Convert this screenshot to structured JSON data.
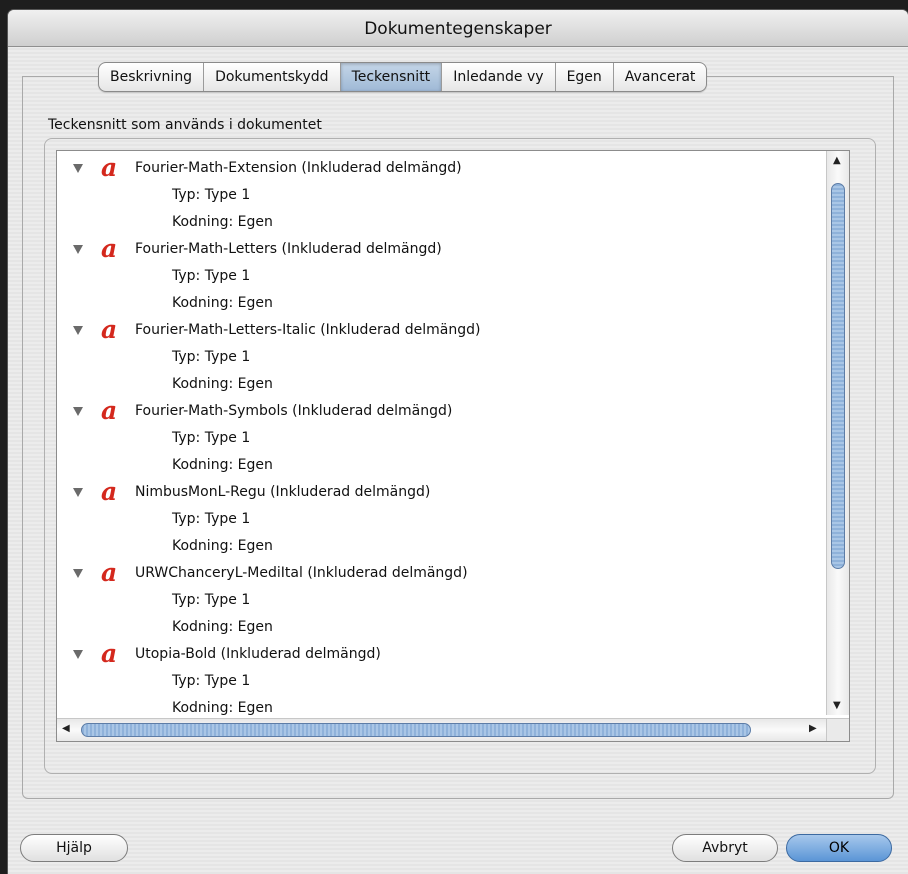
{
  "window": {
    "title": "Dokumentegenskaper"
  },
  "tabs": [
    {
      "label": "Beskrivning"
    },
    {
      "label": "Dokumentskydd"
    },
    {
      "label": "Teckensnitt",
      "active": true
    },
    {
      "label": "Inledande vy"
    },
    {
      "label": "Egen"
    },
    {
      "label": "Avancerat"
    }
  ],
  "fonts_section": {
    "label": "Teckensnitt som används i dokumentet"
  },
  "fonts": [
    {
      "name": "Fourier-Math-Extension (Inkluderad delmängd)",
      "type": "Typ: Type 1",
      "encoding": "Kodning: Egen"
    },
    {
      "name": "Fourier-Math-Letters (Inkluderad delmängd)",
      "type": "Typ: Type 1",
      "encoding": "Kodning: Egen"
    },
    {
      "name": "Fourier-Math-Letters-Italic (Inkluderad delmängd)",
      "type": "Typ: Type 1",
      "encoding": "Kodning: Egen"
    },
    {
      "name": "Fourier-Math-Symbols (Inkluderad delmängd)",
      "type": "Typ: Type 1",
      "encoding": "Kodning: Egen"
    },
    {
      "name": "NimbusMonL-Regu (Inkluderad delmängd)",
      "type": "Typ: Type 1",
      "encoding": "Kodning: Egen"
    },
    {
      "name": "URWChanceryL-MediItal (Inkluderad delmängd)",
      "type": "Typ: Type 1",
      "encoding": "Kodning: Egen"
    },
    {
      "name": "Utopia-Bold (Inkluderad delmängd)",
      "type": "Typ: Type 1",
      "encoding": "Kodning: Egen"
    }
  ],
  "font_icon_glyph": "a",
  "buttons": {
    "help": "Hjälp",
    "cancel": "Avbryt",
    "ok": "OK"
  },
  "colors": {
    "font_icon": "#d4281d",
    "default_button": "#5b95d6",
    "active_tab": "#a9c0db"
  }
}
